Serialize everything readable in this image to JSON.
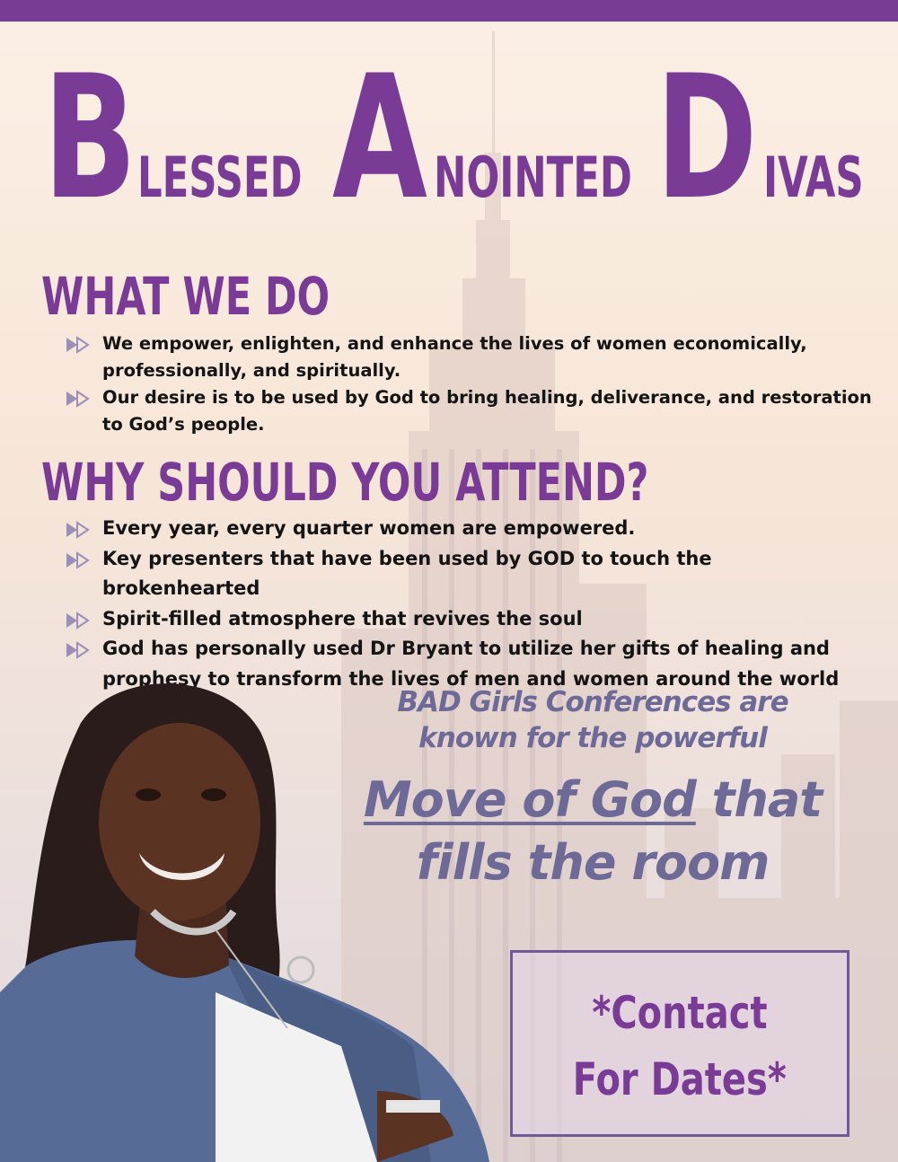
{
  "title": {
    "word1_cap": "B",
    "word1_rest": "LESSED",
    "word2_cap": "A",
    "word2_rest": "NOINTED",
    "word3_cap": "D",
    "word3_rest": "IVAS"
  },
  "what_we_do": {
    "heading": "WHAT WE DO",
    "items": [
      "We empower, enlighten, and enhance the lives of women economically, professionally, and spiritually.",
      "Our desire is to be used by God to bring healing, deliverance, and restoration to God’s people."
    ]
  },
  "why_attend": {
    "heading": "WHY SHOULD YOU ATTEND?",
    "items": [
      "Every year, every quarter women are empowered.",
      "Key presenters that have been used by GOD to touch the brokenhearted",
      "Spirit-filled atmosphere that revives the soul",
      "God has personally used Dr Bryant to utilize her gifts of healing and prophesy to transform the lives of men and women around the world"
    ]
  },
  "tagline": {
    "line1": "BAD Girls Conferences are",
    "line2": "known for the powerful",
    "line3_underlined": "Move of God",
    "line3_rest": " that",
    "line4": "fills the room"
  },
  "contact": {
    "line1": "*Contact",
    "line2": "For Dates*"
  },
  "colors": {
    "brand_purple": "#7a3b97",
    "tagline_slate": "#6e6a98",
    "top_bar": "#7a3b97"
  },
  "icons": {
    "bullet": "double-arrow-icon"
  }
}
